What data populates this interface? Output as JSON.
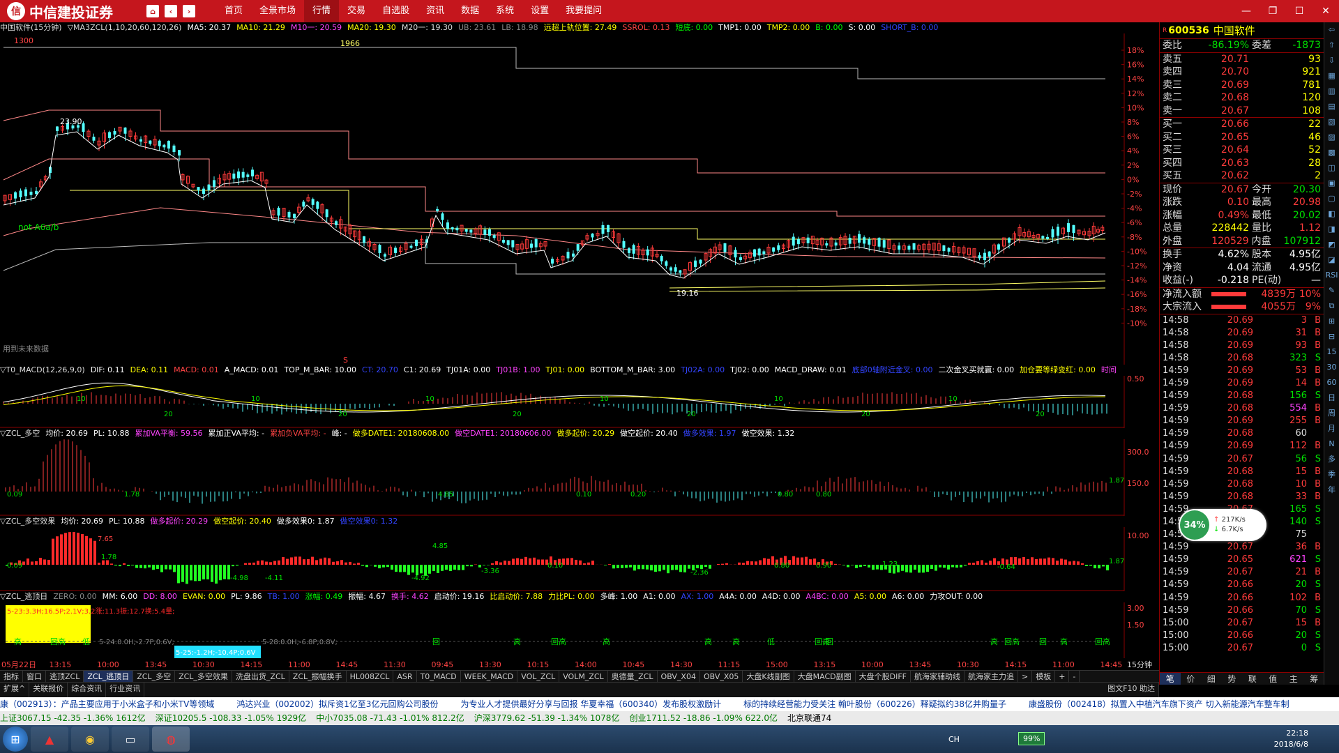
{
  "titlebar": {
    "logo_mark": "信",
    "app_name": "中信建投证券",
    "menu": [
      "首页",
      "全景市场",
      "行情",
      "交易",
      "自选股",
      "资讯",
      "数据",
      "系统",
      "设置",
      "我要提问"
    ],
    "active_menu": "行情",
    "controls": [
      "—",
      "❐",
      "☐",
      "✕"
    ]
  },
  "main_info": {
    "items": [
      {
        "text": "中国软件(15分钟)",
        "color": "#dddddd"
      },
      {
        "text": "▽MA3ZCL(1,10,20,60,120,26)",
        "color": "#dddddd"
      },
      {
        "text": "MA5: 20.37",
        "color": "#ffffff"
      },
      {
        "text": "MA10: 21.29",
        "color": "#ffff00"
      },
      {
        "text": "M10一: 20.59",
        "color": "#ff44ff"
      },
      {
        "text": "MA20: 19.30",
        "color": "#ffff00"
      },
      {
        "text": "M20一: 19.30",
        "color": "#dddddd"
      },
      {
        "text": "UB: 23.61",
        "color": "#888888"
      },
      {
        "text": "LB: 18.98",
        "color": "#888888"
      },
      {
        "text": "远超上轨位置: 27.49",
        "color": "#ffff00"
      },
      {
        "text": "SSROL: 0.13",
        "color": "#ff4444"
      },
      {
        "text": "短底: 0.00",
        "color": "#00ff00"
      },
      {
        "text": "TMP1: 0.00",
        "color": "#ffffff"
      },
      {
        "text": "TMP2: 0.00",
        "color": "#ffff00"
      },
      {
        "text": "B: 0.00",
        "color": "#00ff00"
      },
      {
        "text": "S: 0.00",
        "color": "#ffffff"
      },
      {
        "text": "SHORT_B: 0.00",
        "color": "#3344ff"
      }
    ]
  },
  "main_chart": {
    "labels": {
      "top_left": "1300",
      "top_mid": "1966",
      "price_high": "23.90",
      "price_low": "19.16",
      "signal": "not A6a/b",
      "future": "用到未来数据",
      "mark": "S"
    },
    "y_ticks": [
      "18%",
      "16%",
      "14%",
      "12%",
      "10%",
      "8%",
      "6%",
      "4%",
      "2%",
      "0%",
      "-2%",
      "-4%",
      "-6%",
      "-8%",
      "-10%",
      "-12%",
      "-14%",
      "-16%",
      "-18%",
      "-10%"
    ]
  },
  "macd_info": {
    "items": [
      {
        "text": "▽T0_MACD(12,26,9,0)",
        "color": "#dddddd"
      },
      {
        "text": "DIF: 0.11",
        "color": "#ffffff"
      },
      {
        "text": "DEA: 0.11",
        "color": "#ffff00"
      },
      {
        "text": "MACD: 0.01",
        "color": "#ff4444"
      },
      {
        "text": "A_MACD: 0.01",
        "color": "#ffffff"
      },
      {
        "text": "TOP_M_BAR: 10.00",
        "color": "#ffffff"
      },
      {
        "text": "CT: 20.70",
        "color": "#3344ff"
      },
      {
        "text": "C1: 20.69",
        "color": "#ffffff"
      },
      {
        "text": "TJ01A: 0.00",
        "color": "#ffffff"
      },
      {
        "text": "TJ01B: 1.00",
        "color": "#ff44ff"
      },
      {
        "text": "TJ01: 0.00",
        "color": "#ffff00"
      },
      {
        "text": "BOTTOM_M_BAR: 3.00",
        "color": "#ffffff"
      },
      {
        "text": "TJ02A: 0.00",
        "color": "#3344ff"
      },
      {
        "text": "TJ02: 0.00",
        "color": "#ffffff"
      },
      {
        "text": "MACD_DRAW: 0.01",
        "color": "#ffffff"
      },
      {
        "text": "底部0轴附近金叉: 0.00",
        "color": "#3344ff"
      },
      {
        "text": "二次金叉买就赢: 0.00",
        "color": "#ffffff"
      },
      {
        "text": "加仓要等绿变红: 0.00",
        "color": "#ffff00"
      },
      {
        "text": "时间",
        "color": "#ff44ff"
      }
    ],
    "y_ticks": [
      "0.50"
    ],
    "marks": [
      "10",
      "20",
      "10",
      "20",
      "10",
      "20",
      "10",
      "20",
      "10",
      "20",
      "10",
      "20"
    ]
  },
  "duokong_info": {
    "items": [
      {
        "text": "▽ZCL_多空",
        "color": "#dddddd"
      },
      {
        "text": "均价: 20.69",
        "color": "#ffffff"
      },
      {
        "text": "PL: 10.88",
        "color": "#ffffff"
      },
      {
        "text": "累加VA平衡: 59.56",
        "color": "#ff44ff"
      },
      {
        "text": "累加正VA平均: -",
        "color": "#ffffff"
      },
      {
        "text": "累加负VA平均: -",
        "color": "#ff4444"
      },
      {
        "text": "峰: -",
        "color": "#ffffff"
      },
      {
        "text": "做多DATE1: 20180608.00",
        "color": "#ffff00"
      },
      {
        "text": "做空DATE1: 20180606.00",
        "color": "#ff44ff"
      },
      {
        "text": "做多起价: 20.29",
        "color": "#ffff00"
      },
      {
        "text": "做空起价: 20.40",
        "color": "#ffffff"
      },
      {
        "text": "做多效果: 1.97",
        "color": "#3344ff"
      },
      {
        "text": "做空效果: 1.32",
        "color": "#ffffff"
      }
    ],
    "y_ticks": [
      "300.0",
      "150.0"
    ],
    "labels": [
      "0.09",
      "1.78",
      "4.85",
      "0.10",
      "0.20",
      "0.80",
      "0.80",
      "1.87"
    ]
  },
  "xiaoguo_info": {
    "items": [
      {
        "text": "▽ZCL_多空效果",
        "color": "#dddddd"
      },
      {
        "text": "均价: 20.69",
        "color": "#ffffff"
      },
      {
        "text": "PL: 10.88",
        "color": "#ffffff"
      },
      {
        "text": "做多起价: 20.29",
        "color": "#ff44ff"
      },
      {
        "text": "做空起价: 20.40",
        "color": "#ffff00"
      },
      {
        "text": "做多效果0: 1.87",
        "color": "#ffffff"
      },
      {
        "text": "做空效果0: 1.32",
        "color": "#3344ff"
      }
    ],
    "y_ticks": [
      "10.00"
    ],
    "labels": [
      "7.65",
      "0.09",
      "1.78",
      "-4.98",
      "-4.11",
      "4.85",
      "-4.92",
      "-3.36",
      "0.10",
      "-2.36",
      "0.80",
      "0.90",
      "1.23",
      "-0.64",
      "1.87"
    ]
  },
  "taori_info": {
    "items": [
      {
        "text": "▽ZCL_逃顶日",
        "color": "#dddddd"
      },
      {
        "text": "ZERO: 0.00",
        "color": "#888888"
      },
      {
        "text": "MM: 6.00",
        "color": "#ffffff"
      },
      {
        "text": "DD: 8.00",
        "color": "#ff44ff"
      },
      {
        "text": "EVAN: 0.00",
        "color": "#ffff00"
      },
      {
        "text": "PL: 9.86",
        "color": "#ffffff"
      },
      {
        "text": "TB: 1.00",
        "color": "#3344ff"
      },
      {
        "text": "涨幅: 0.49",
        "color": "#00ff00"
      },
      {
        "text": "振幅: 4.67",
        "color": "#ffffff"
      },
      {
        "text": "换手: 4.62",
        "color": "#ff44ff"
      },
      {
        "text": "启动价: 19.16",
        "color": "#ffffff"
      },
      {
        "text": "比启动价: 7.88",
        "color": "#ffff00"
      },
      {
        "text": "力比PL: 0.00",
        "color": "#ffff00"
      },
      {
        "text": "多峰: 1.00",
        "color": "#ffffff"
      },
      {
        "text": "A1: 0.00",
        "color": "#ffffff"
      },
      {
        "text": "AX: 1.00",
        "color": "#3344ff"
      },
      {
        "text": "A4A: 0.00",
        "color": "#ffffff"
      },
      {
        "text": "A4D: 0.00",
        "color": "#ffffff"
      },
      {
        "text": "A4BC: 0.00",
        "color": "#ff44ff"
      },
      {
        "text": "A5: 0.00",
        "color": "#ffff00"
      },
      {
        "text": "A6: 0.00",
        "color": "#ffffff"
      },
      {
        "text": "力攻OUT: 0.00",
        "color": "#ffffff"
      }
    ],
    "y_ticks": [
      "3.00",
      "1.50"
    ],
    "box1": "5-23:3.3H;16.5P;2.1V;3.2涨;11.3振;12.7换;5.4量;",
    "box2": "5-25:-1.2H;-10.4P;0.6V",
    "note1": "5-24:0.0H;-2.7P;0.6V;",
    "note2": "5-28:0.0H;-6.8P;0.8V;",
    "signals": [
      "高",
      "回高",
      "低",
      "回",
      "高",
      "回高",
      "高",
      "高",
      "高",
      "低",
      "回高",
      "回",
      "高",
      "回高",
      "回",
      "高",
      "回高"
    ]
  },
  "time_axis": {
    "labels": [
      "05月22日",
      "13:15",
      "10:00",
      "13:45",
      "10:30",
      "14:15",
      "11:00",
      "14:45",
      "11:30",
      "09:45",
      "13:30",
      "10:15",
      "14:00",
      "10:45",
      "14:30",
      "11:15",
      "15:00",
      "13:15",
      "10:00",
      "13:45",
      "10:30",
      "14:15",
      "11:00",
      "14:45"
    ],
    "period": "15分钟"
  },
  "tabs1": [
    "指标",
    "窗口",
    "逃顶ZCL",
    "ZCL_逃顶日",
    "ZCL_多空",
    "ZCL_多空效果",
    "洗盘出货_ZCL",
    "ZCL_振幅换手",
    "HL008ZCL",
    "ASR",
    "T0_MACD",
    "WEEK_MACD",
    "VOL_ZCL",
    "VOLM_ZCL",
    "奥德量_ZCL",
    "OBV_X04",
    "OBV_X05",
    "大盘K线副图",
    "大盘MACD副图",
    "大盘个股DIFF",
    "航海家辅助线",
    "航海家主力追",
    ">",
    "模板",
    "+",
    "-"
  ],
  "tabs1_active": "ZCL_逃顶日",
  "tabs2": [
    "扩展^",
    "关联报价",
    "综合资讯",
    "行业资讯"
  ],
  "tabs2_right": "图文F10 助达",
  "quote": {
    "code": "600536",
    "name": "中国软件",
    "weibi": {
      "label": "委比",
      "value": "-86.19%",
      "label2": "委差",
      "value2": "-1873"
    },
    "sells": [
      {
        "label": "卖五",
        "price": "20.71",
        "vol": "93"
      },
      {
        "label": "卖四",
        "price": "20.70",
        "vol": "921"
      },
      {
        "label": "卖三",
        "price": "20.69",
        "vol": "781"
      },
      {
        "label": "卖二",
        "price": "20.68",
        "vol": "120"
      },
      {
        "label": "卖一",
        "price": "20.67",
        "vol": "108"
      }
    ],
    "buys": [
      {
        "label": "买一",
        "price": "20.66",
        "vol": "22"
      },
      {
        "label": "买二",
        "price": "20.65",
        "vol": "46"
      },
      {
        "label": "买三",
        "price": "20.64",
        "vol": "52"
      },
      {
        "label": "买四",
        "price": "20.63",
        "vol": "28"
      },
      {
        "label": "买五",
        "price": "20.62",
        "vol": "2"
      }
    ],
    "stats": [
      {
        "l1": "现价",
        "v1": "20.67",
        "c1": "red",
        "l2": "今开",
        "v2": "20.30",
        "c2": "green"
      },
      {
        "l1": "涨跌",
        "v1": "0.10",
        "c1": "red",
        "l2": "最高",
        "v2": "20.98",
        "c2": "red"
      },
      {
        "l1": "涨幅",
        "v1": "0.49%",
        "c1": "red",
        "l2": "最低",
        "v2": "20.02",
        "c2": "green"
      },
      {
        "l1": "总量",
        "v1": "228442",
        "c1": "yellow",
        "l2": "量比",
        "v2": "1.12",
        "c2": "red"
      },
      {
        "l1": "外盘",
        "v1": "120529",
        "c1": "red",
        "l2": "内盘",
        "v2": "107912",
        "c2": "green"
      }
    ],
    "stats2": [
      {
        "l1": "换手",
        "v1": "4.62%",
        "l2": "股本",
        "v2": "4.95亿"
      },
      {
        "l1": "净资",
        "v1": "4.04",
        "l2": "流通",
        "v2": "4.95亿"
      },
      {
        "l1": "收益(-)",
        "v1": "-0.218",
        "l2": "PE(动)",
        "v2": "—"
      }
    ],
    "flows": [
      {
        "label": "净流入额",
        "value": "4839万",
        "pct": "10%"
      },
      {
        "label": "大宗流入",
        "value": "4055万",
        "pct": "9%"
      }
    ],
    "ticks": [
      {
        "t": "14:58",
        "p": "20.69",
        "v": "3",
        "s": "B",
        "c": "red"
      },
      {
        "t": "14:58",
        "p": "20.69",
        "v": "31",
        "s": "B",
        "c": "red"
      },
      {
        "t": "14:58",
        "p": "20.69",
        "v": "93",
        "s": "B",
        "c": "red"
      },
      {
        "t": "14:58",
        "p": "20.68",
        "v": "323",
        "s": "S",
        "c": "green"
      },
      {
        "t": "14:59",
        "p": "20.69",
        "v": "53",
        "s": "B",
        "c": "red"
      },
      {
        "t": "14:59",
        "p": "20.69",
        "v": "14",
        "s": "B",
        "c": "red"
      },
      {
        "t": "14:59",
        "p": "20.68",
        "v": "156",
        "s": "S",
        "c": "green"
      },
      {
        "t": "14:59",
        "p": "20.68",
        "v": "554",
        "s": "B",
        "c": "magenta"
      },
      {
        "t": "14:59",
        "p": "20.69",
        "v": "255",
        "s": "B",
        "c": "red"
      },
      {
        "t": "14:59",
        "p": "20.68",
        "v": "60",
        "s": "",
        "c": "white"
      },
      {
        "t": "14:59",
        "p": "20.69",
        "v": "112",
        "s": "B",
        "c": "red"
      },
      {
        "t": "14:59",
        "p": "20.67",
        "v": "56",
        "s": "S",
        "c": "green"
      },
      {
        "t": "14:59",
        "p": "20.68",
        "v": "15",
        "s": "B",
        "c": "red"
      },
      {
        "t": "14:59",
        "p": "20.68",
        "v": "10",
        "s": "B",
        "c": "red"
      },
      {
        "t": "14:59",
        "p": "20.68",
        "v": "33",
        "s": "B",
        "c": "red"
      },
      {
        "t": "14:59",
        "p": "20.67",
        "v": "165",
        "s": "S",
        "c": "green"
      },
      {
        "t": "14:59",
        "p": "20.67",
        "v": "140",
        "s": "S",
        "c": "green"
      },
      {
        "t": "14:59",
        "p": "20.67",
        "v": "75",
        "s": "",
        "c": "white"
      },
      {
        "t": "14:59",
        "p": "20.67",
        "v": "36",
        "s": "B",
        "c": "red"
      },
      {
        "t": "14:59",
        "p": "20.65",
        "v": "621",
        "s": "S",
        "c": "magenta"
      },
      {
        "t": "14:59",
        "p": "20.67",
        "v": "21",
        "s": "B",
        "c": "red"
      },
      {
        "t": "14:59",
        "p": "20.66",
        "v": "20",
        "s": "S",
        "c": "green"
      },
      {
        "t": "14:59",
        "p": "20.66",
        "v": "102",
        "s": "B",
        "c": "red"
      },
      {
        "t": "14:59",
        "p": "20.66",
        "v": "70",
        "s": "S",
        "c": "green"
      },
      {
        "t": "15:00",
        "p": "20.67",
        "v": "15",
        "s": "B",
        "c": "red"
      },
      {
        "t": "15:00",
        "p": "20.66",
        "v": "20",
        "s": "S",
        "c": "green"
      },
      {
        "t": "15:00",
        "p": "20.67",
        "v": "0",
        "s": "S",
        "c": "green"
      }
    ],
    "bottom_tabs": [
      "笔",
      "价",
      "细",
      "势",
      "联",
      "值",
      "主",
      "筹"
    ],
    "net": {
      "pct": "34%",
      "up": "217K/s",
      "down": "6.7K/s"
    }
  },
  "iconbar": [
    "⇦",
    "⇧",
    "⇩",
    "▦",
    "▥",
    "▤",
    "▧",
    "▨",
    "▩",
    "◫",
    "▣",
    "▢",
    "◧",
    "◨",
    "◩",
    "◪",
    "RSI",
    "✎",
    "⧉",
    "⊞",
    "⊟",
    "15",
    "30",
    "60",
    "日",
    "周",
    "月",
    "N",
    "多",
    "季",
    "年"
  ],
  "news": [
    "康（002913）：产品主要应用于小米盒子和小米TV等领域",
    "鸿达兴业（002002）拟斥资1亿至3亿元回购公司股份",
    "为专业人才提供最好分享与回报 华夏幸福（600340）发布股权激励计",
    "标的持续经营能力受关注 翰叶股份（600226）释疑拟约38亿并购量子",
    "康盛股份（002418）拟置入中植汽车旗下资产 切入新能源汽车整车制"
  ],
  "indices": [
    {
      "text": "上证3067.15 -42.35 -1.36% 1612亿"
    },
    {
      "text": "深证10205.5 -108.33 -1.05% 1929亿"
    },
    {
      "text": "中小7035.08 -71.43 -1.01% 812.2亿"
    },
    {
      "text": "沪深3779.62 -51.39 -1.34% 1078亿"
    },
    {
      "text": "创业1711.52 -18.86 -1.09% 622.0亿"
    },
    {
      "text": "北京联通74"
    }
  ],
  "taskbar": {
    "time": "22:18",
    "date": "2018/6/8",
    "lang": "CH",
    "battery": "99%"
  }
}
